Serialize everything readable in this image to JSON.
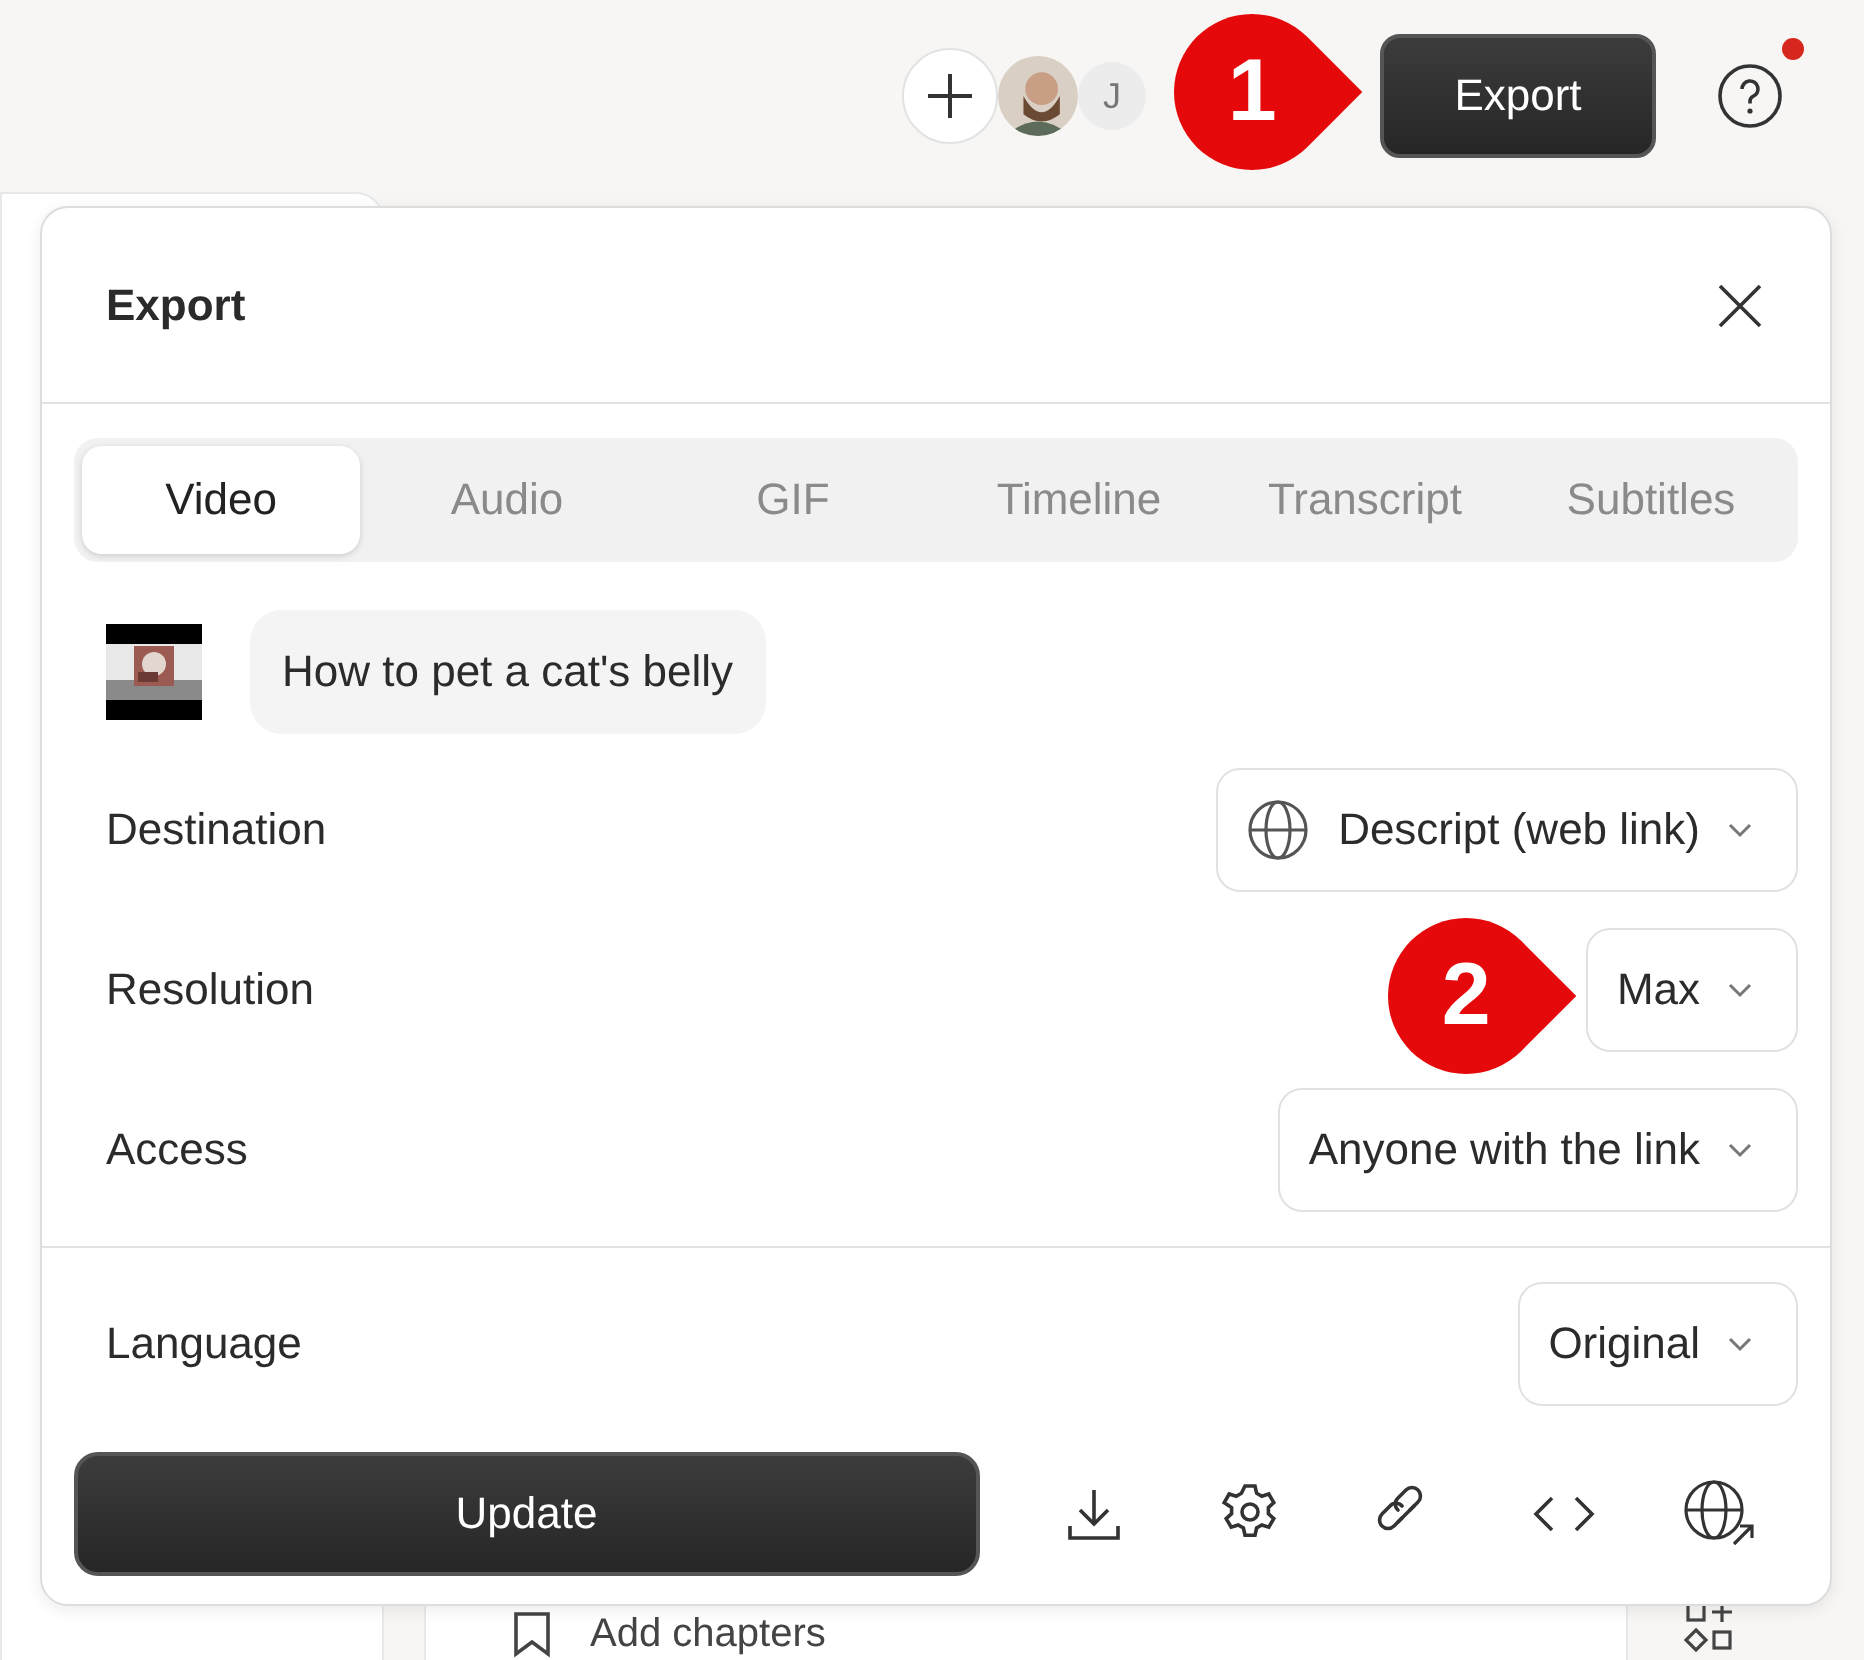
{
  "topbar": {
    "avatar_initial": "J",
    "export_button": "Export"
  },
  "callouts": [
    {
      "number": "1"
    },
    {
      "number": "2"
    }
  ],
  "background": {
    "list_item": "Add chapters"
  },
  "dialog": {
    "title": "Export",
    "tabs": [
      {
        "label": "Video",
        "selected": true
      },
      {
        "label": "Audio",
        "selected": false
      },
      {
        "label": "GIF",
        "selected": false
      },
      {
        "label": "Timeline",
        "selected": false
      },
      {
        "label": "Transcript",
        "selected": false
      },
      {
        "label": "Subtitles",
        "selected": false
      }
    ],
    "project_name": "How to pet a cat's belly",
    "settings": [
      {
        "label": "Destination",
        "value": "Descript (web link)",
        "kind": "globe"
      },
      {
        "label": "Resolution",
        "value": "Max",
        "kind": "plain"
      },
      {
        "label": "Access",
        "value": "Anyone with the link",
        "kind": "plain"
      }
    ],
    "language": {
      "label": "Language",
      "value": "Original"
    },
    "primary_button": "Update"
  }
}
